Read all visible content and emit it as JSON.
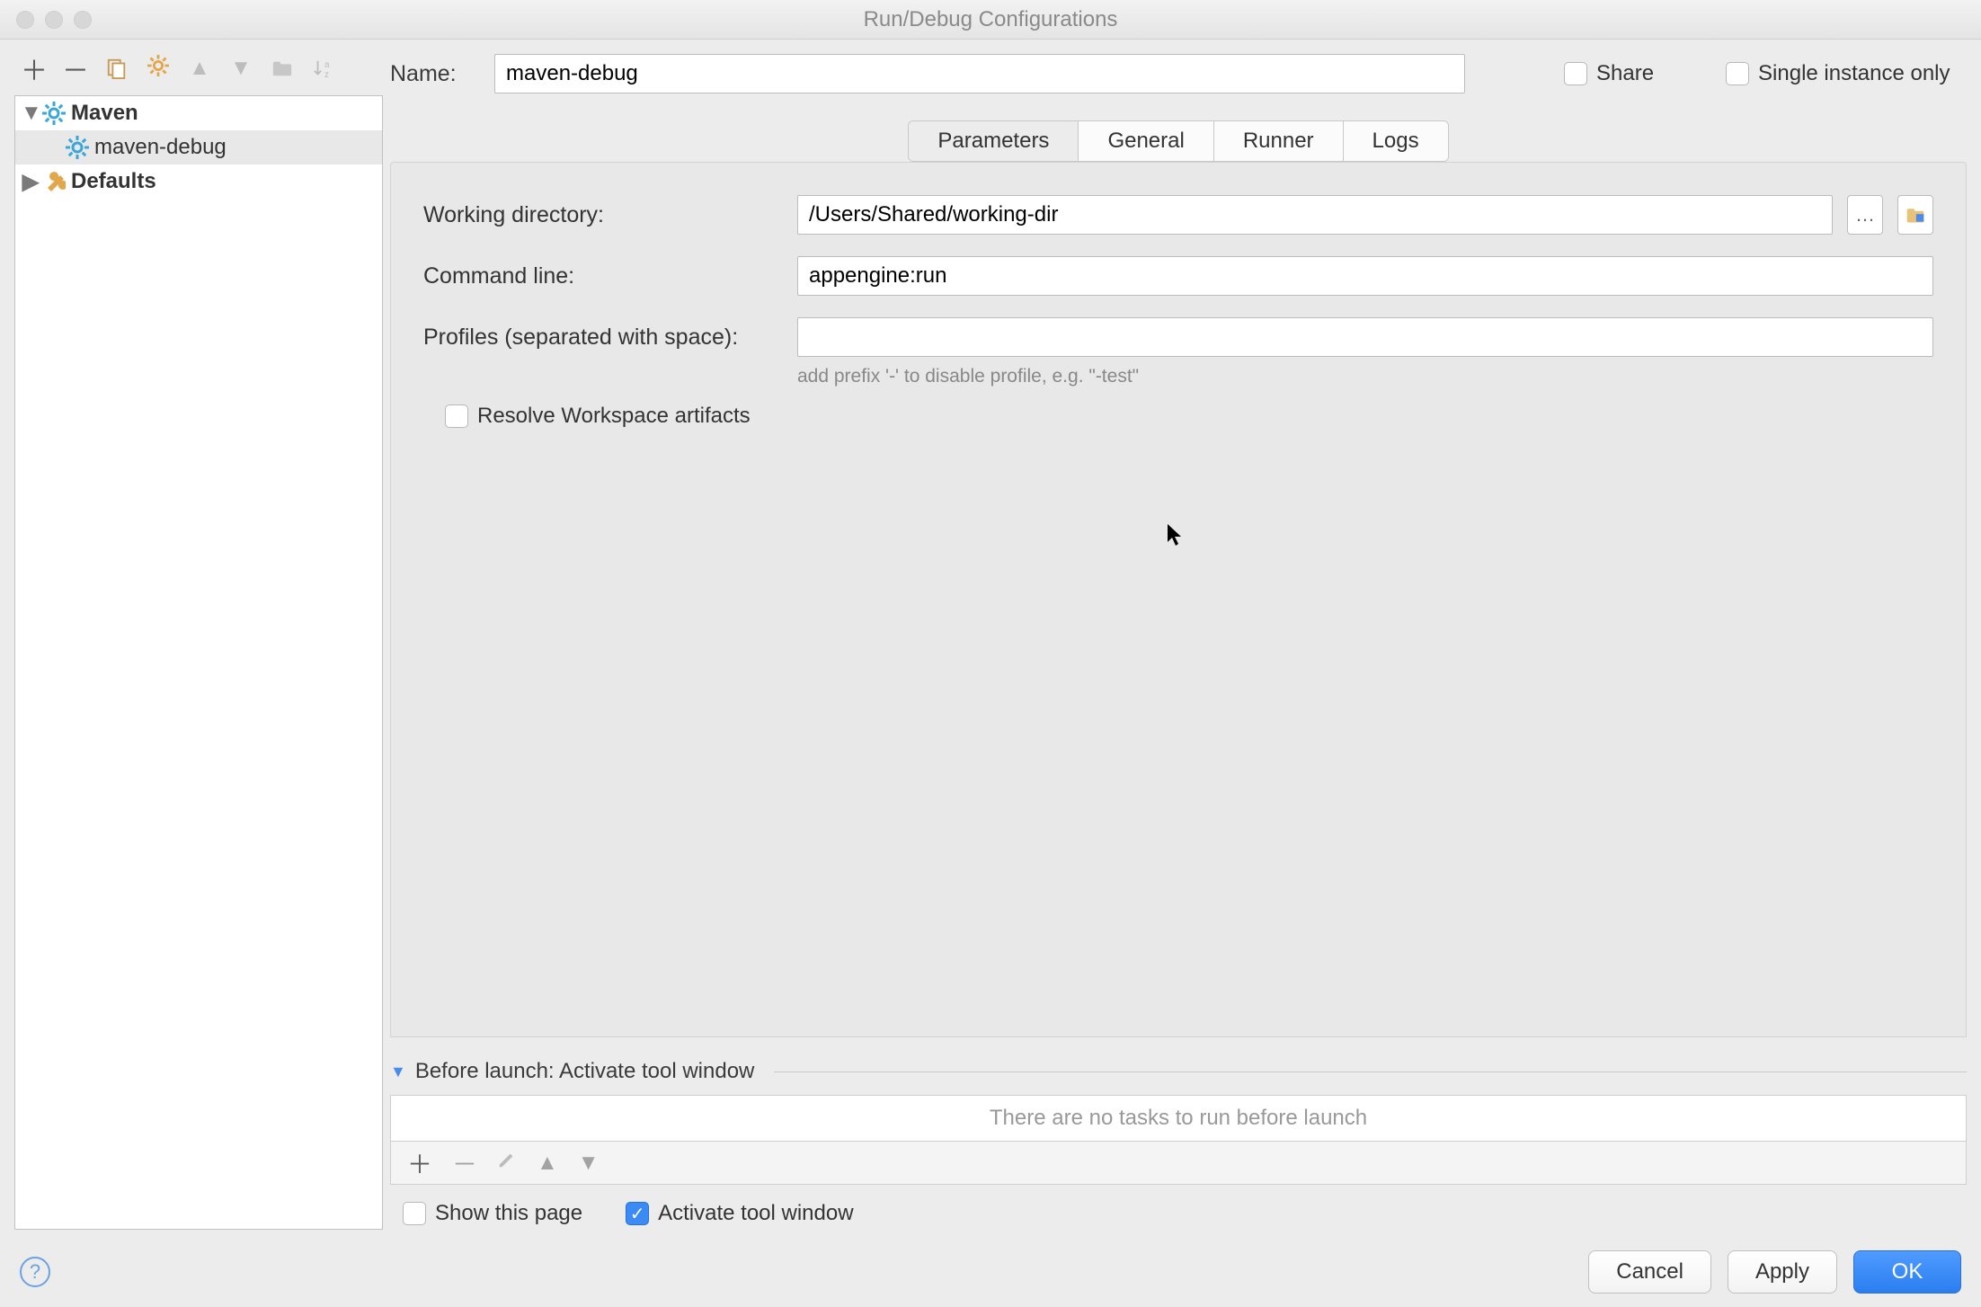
{
  "window": {
    "title": "Run/Debug Configurations"
  },
  "sidebar": {
    "items": [
      {
        "label": "Maven",
        "expanded": true,
        "kind": "maven"
      },
      {
        "label": "maven-debug",
        "kind": "maven-child"
      },
      {
        "label": "Defaults",
        "kind": "defaults"
      }
    ]
  },
  "name_row": {
    "label": "Name:",
    "value": "maven-debug",
    "share_label": "Share",
    "single_instance_label": "Single instance only",
    "share_checked": false,
    "single_instance_checked": false
  },
  "tabs": {
    "items": [
      {
        "label": "Parameters",
        "active": true
      },
      {
        "label": "General",
        "active": false
      },
      {
        "label": "Runner",
        "active": false
      },
      {
        "label": "Logs",
        "active": false
      }
    ]
  },
  "parameters": {
    "working_dir_label": "Working directory:",
    "working_dir_value": "/Users/Shared/working-dir",
    "command_line_label": "Command line:",
    "command_line_value": "appengine:run",
    "profiles_label": "Profiles (separated with space):",
    "profiles_value": "",
    "profiles_hint": "add prefix '-' to disable profile, e.g. \"-test\"",
    "resolve_label": "Resolve Workspace artifacts",
    "resolve_checked": false
  },
  "before_launch": {
    "title": "Before launch: Activate tool window",
    "empty_text": "There are no tasks to run before launch",
    "show_this_page_label": "Show this page",
    "show_this_page_checked": false,
    "activate_tool_window_label": "Activate tool window",
    "activate_tool_window_checked": true
  },
  "footer": {
    "cancel_label": "Cancel",
    "apply_label": "Apply",
    "ok_label": "OK"
  }
}
